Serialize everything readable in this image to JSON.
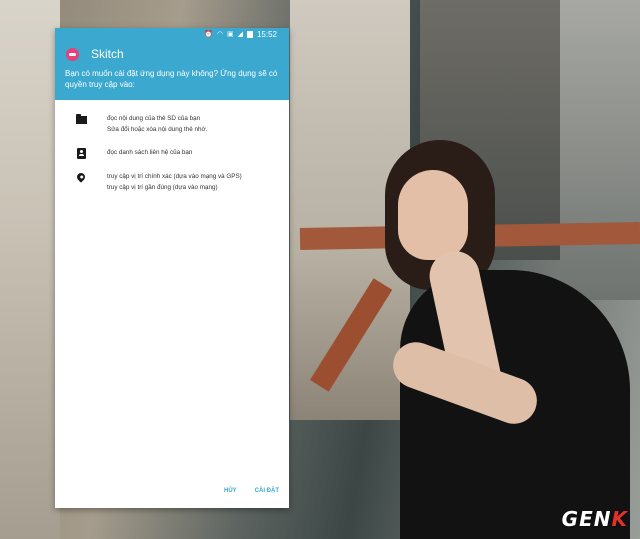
{
  "status_bar": {
    "time": "15:52",
    "icons": [
      "alarm-icon",
      "wifi-icon",
      "sim-icon",
      "signal-icon",
      "battery-icon"
    ]
  },
  "dialog": {
    "app_title": "Skitch",
    "question": "Bạn có muốn cài đặt ứng dụng này không? Ứng dụng sẽ có quyền truy cập vào:",
    "permissions": [
      {
        "icon": "folder-icon",
        "title": "đọc nội dung của thẻ SD của bạn",
        "detail": "Sửa đổi hoặc xóa nội dung thẻ nhớ."
      },
      {
        "icon": "contact-card-icon",
        "title": "đọc danh sách liên hệ của bạn"
      },
      {
        "icon": "location-pin-icon",
        "title": "truy cập vị trí chính xác (dựa vào mạng và GPS)",
        "detail": "truy cập vị trí gần đúng (dựa vào mạng)"
      }
    ],
    "cancel_label": "HỦY",
    "install_label": "CÀI ĐẶT"
  },
  "watermark": {
    "part1": "GEN",
    "part2": "K"
  },
  "colors": {
    "header_bg": "#3ba8cf",
    "app_logo": "#e5417a",
    "button_text": "#3ba8cf"
  }
}
